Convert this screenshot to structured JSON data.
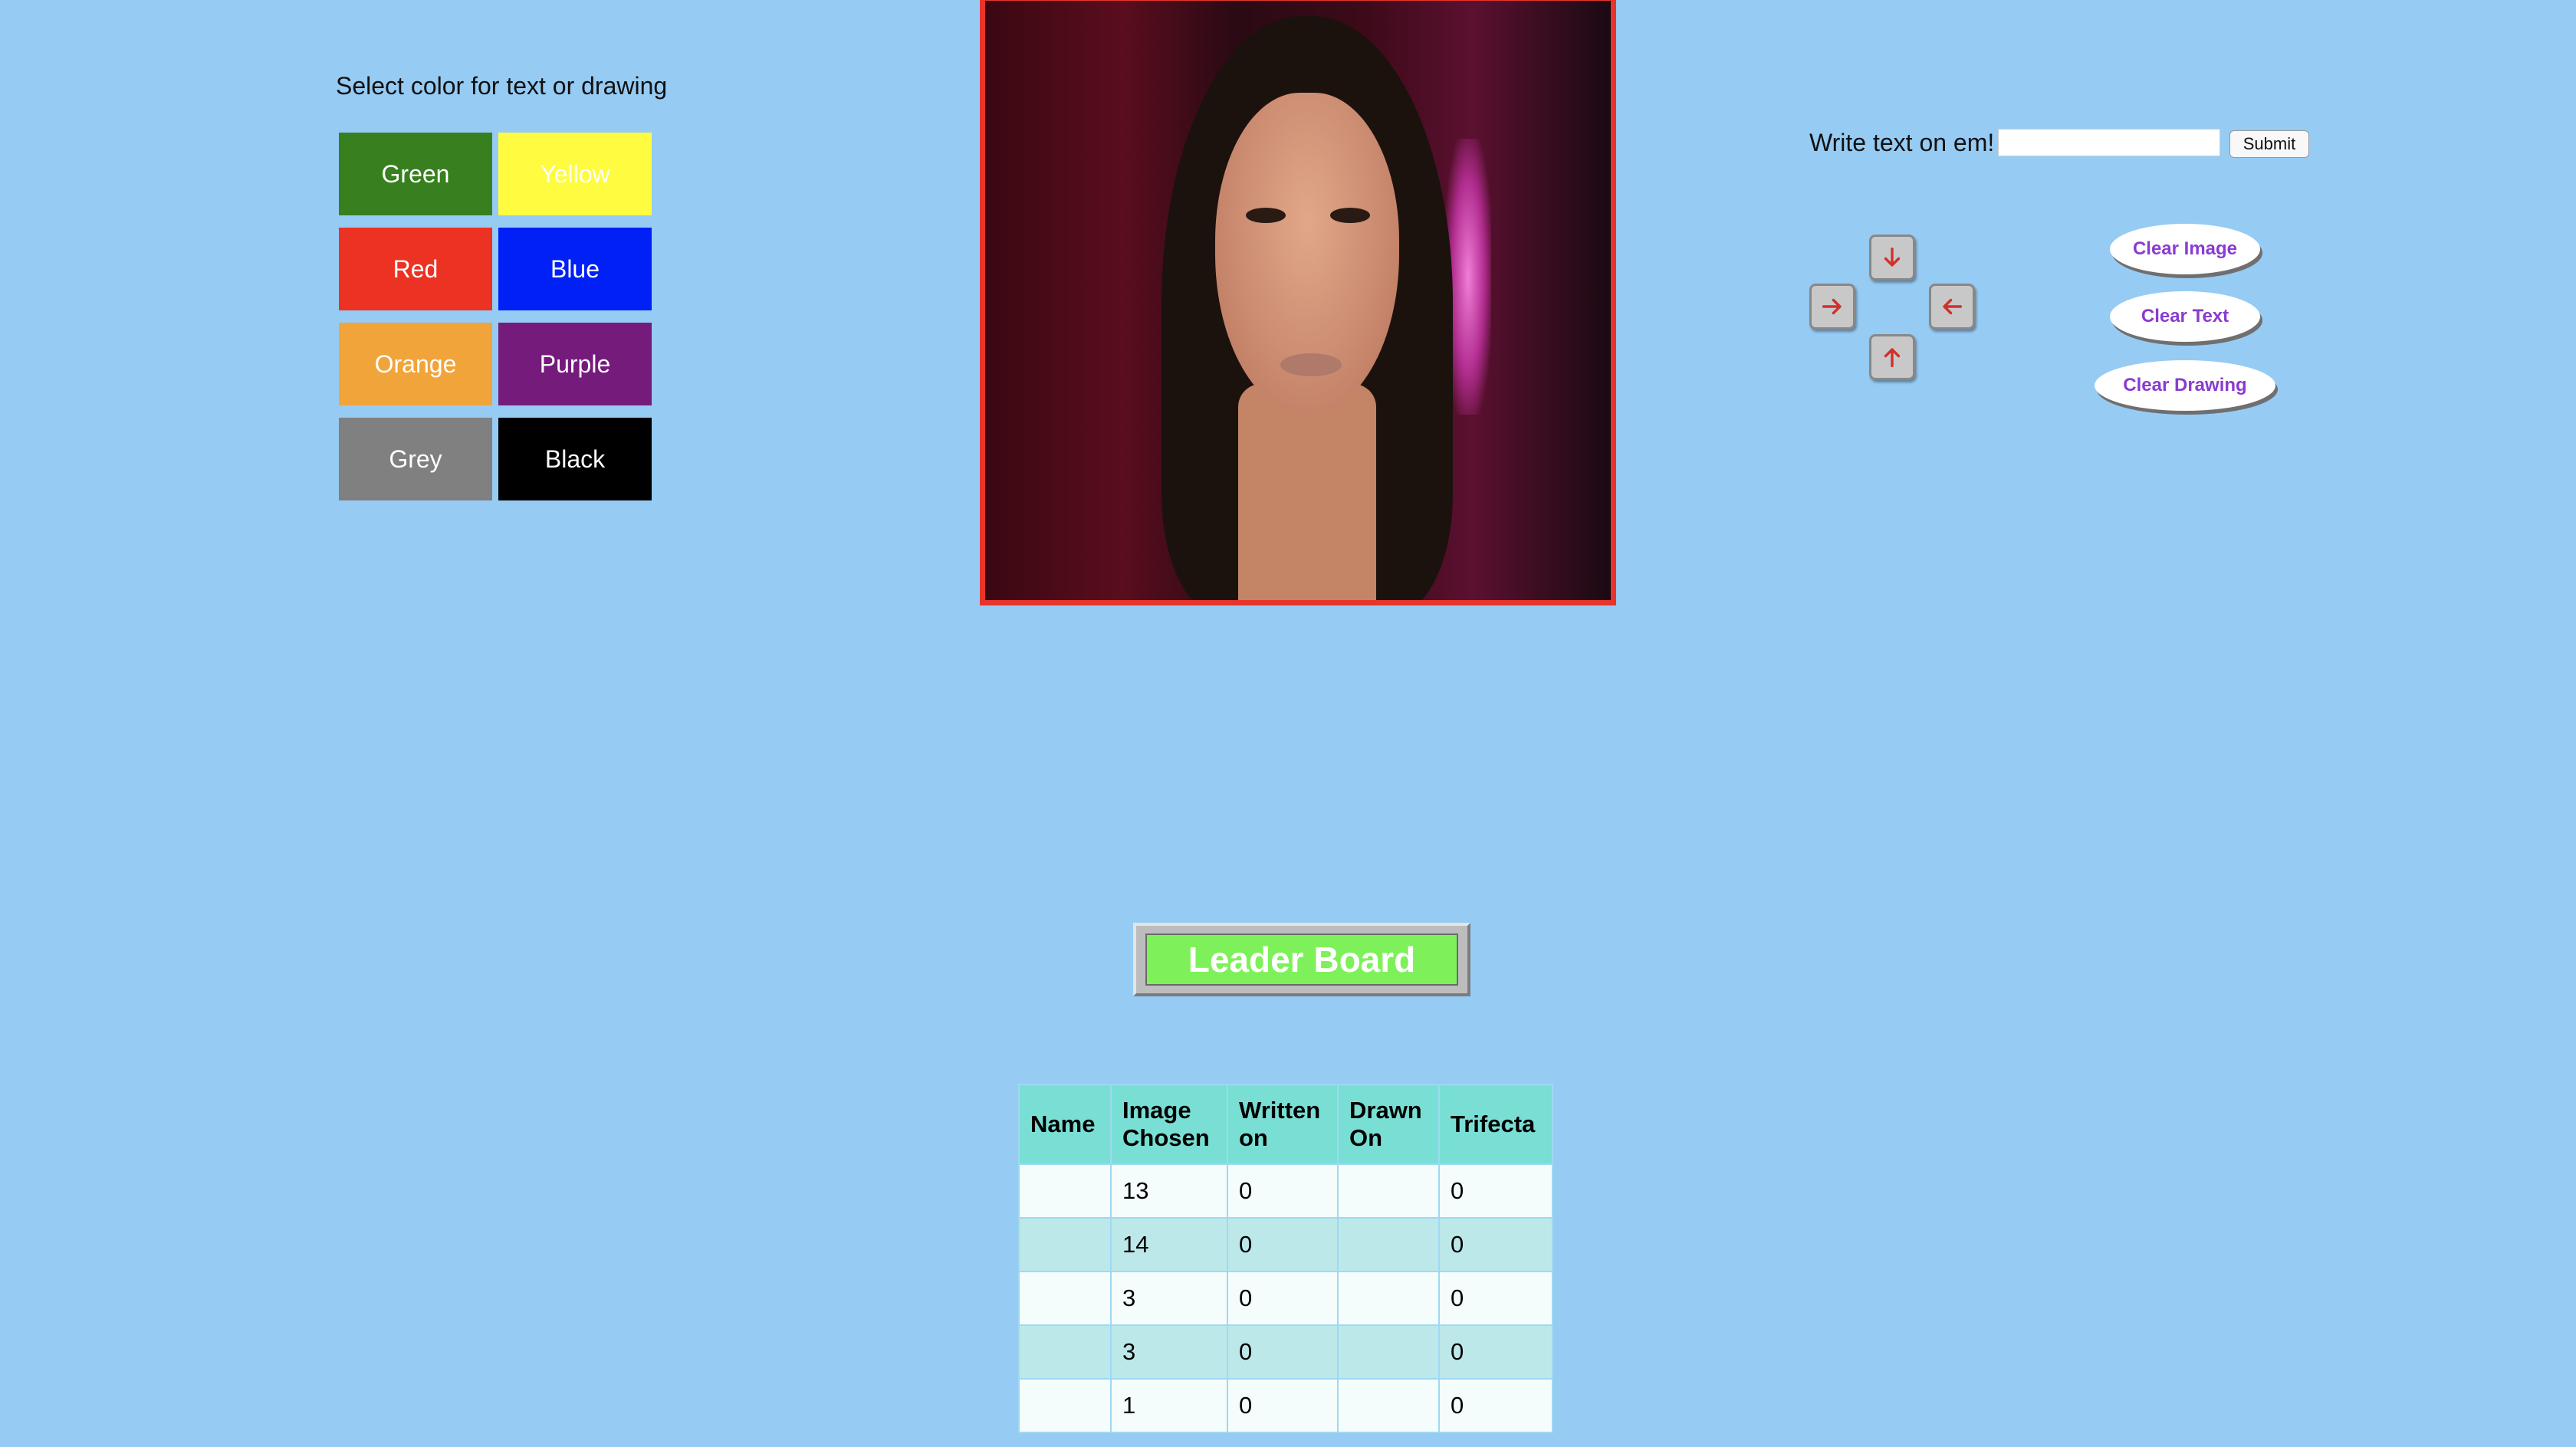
{
  "colors": {
    "title": "Select color for text or drawing",
    "swatches": [
      {
        "label": "Green",
        "hex": "#38801f"
      },
      {
        "label": "Yellow",
        "hex": "#fefb41"
      },
      {
        "label": "Red",
        "hex": "#eb3223"
      },
      {
        "label": "Blue",
        "hex": "#0020f5"
      },
      {
        "label": "Orange",
        "hex": "#f1a43a"
      },
      {
        "label": "Purple",
        "hex": "#741b7c"
      },
      {
        "label": "Grey",
        "hex": "#808080"
      },
      {
        "label": "Black",
        "hex": "#000000"
      }
    ]
  },
  "text_tool": {
    "label": "Write text on em!",
    "input_value": "",
    "submit_label": "Submit"
  },
  "arrows": {
    "down": "arrow-down-icon",
    "right": "arrow-right-icon",
    "left": "arrow-left-icon",
    "up": "arrow-up-icon",
    "color": "#d0302a"
  },
  "clear_buttons": {
    "image": "Clear Image",
    "text": "Clear Text",
    "drawing": "Clear Drawing"
  },
  "leader_board": {
    "title": "Leader Board",
    "columns": [
      "Name",
      "Image Chosen",
      "Written on",
      "Drawn On",
      "Trifecta"
    ],
    "rows": [
      [
        "",
        "13",
        "0",
        "",
        "0"
      ],
      [
        "",
        "14",
        "0",
        "",
        "0"
      ],
      [
        "",
        "3",
        "0",
        "",
        "0"
      ],
      [
        "",
        "3",
        "0",
        "",
        "0"
      ],
      [
        "",
        "1",
        "0",
        "",
        "0"
      ]
    ]
  }
}
